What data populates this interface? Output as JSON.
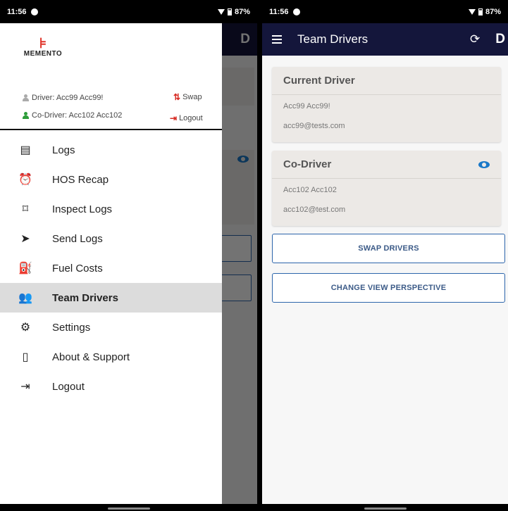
{
  "left_phone": {
    "status": {
      "time": "11:56",
      "battery": "87%"
    },
    "appbar_letter": "D",
    "logo_text": "MEMENTO",
    "driver_label": "Driver: Acc99 Acc99!",
    "codriver_label": "Co-Driver: Acc102 Acc102",
    "swap_label": "Swap",
    "logout_top_label": "Logout",
    "menu": [
      {
        "label": "Logs",
        "icon": "list-icon"
      },
      {
        "label": "HOS Recap",
        "icon": "alarm-clock-icon"
      },
      {
        "label": "Inspect Logs",
        "icon": "inspect-icon"
      },
      {
        "label": "Send Logs",
        "icon": "send-icon"
      },
      {
        "label": "Fuel Costs",
        "icon": "fuel-icon"
      },
      {
        "label": "Team Drivers",
        "icon": "team-icon",
        "active": true
      },
      {
        "label": "Settings",
        "icon": "gear-icon"
      },
      {
        "label": "About & Support",
        "icon": "phone-icon"
      },
      {
        "label": "Logout",
        "icon": "logout-icon"
      }
    ]
  },
  "right_phone": {
    "status": {
      "time": "11:56",
      "battery": "87%"
    },
    "title": "Team Drivers",
    "appbar_letter": "D",
    "current_driver": {
      "header": "Current Driver",
      "name": "Acc99 Acc99!",
      "email": "acc99@tests.com"
    },
    "co_driver": {
      "header": "Co-Driver",
      "name": "Acc102 Acc102",
      "email": "acc102@test.com"
    },
    "swap_button": "SWAP DRIVERS",
    "perspective_button": "CHANGE VIEW PERSPECTIVE"
  },
  "colors": {
    "appbar": "#14163b",
    "accent": "#2c65ab",
    "brand_red": "#e0342a",
    "codriver_green": "#2e9d3a",
    "eye_blue": "#1a78c8"
  }
}
